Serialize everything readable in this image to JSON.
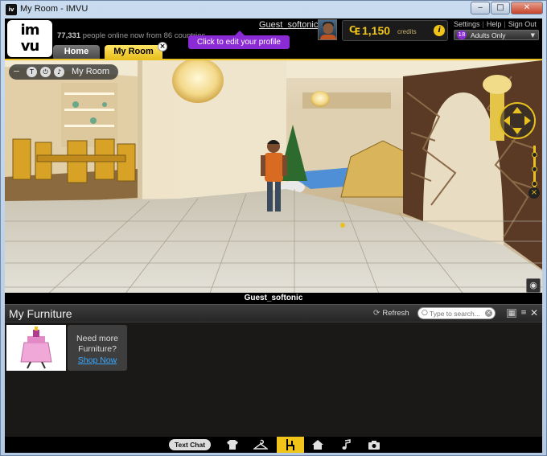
{
  "window": {
    "title": "My Room - IMVU",
    "app_icon": "imvu-icon",
    "minimize": "‒",
    "maximize": "□",
    "close": "✕"
  },
  "header": {
    "logo": "imvu",
    "online_count": "77,331",
    "online_text": "people online now from 86 countries",
    "username": "Guest_softonic",
    "tooltip": "Click to edit your profile",
    "credits_value": "1,150",
    "credits_label": "credits",
    "credits_symbol": "₠",
    "links": [
      "Settings",
      "Help",
      "Sign Out"
    ],
    "adults_badge": "18",
    "adults_label": "Adults Only",
    "tabs": [
      {
        "label": "Home"
      },
      {
        "label": "My Room"
      }
    ],
    "tab_close": "×"
  },
  "scene": {
    "room_name": "My Room",
    "room_controls": [
      "T",
      "⏻",
      "♪"
    ],
    "avatar_name": "Guest_softonic",
    "zoom_plus": "+",
    "zoom_minus": "×"
  },
  "furniture": {
    "title": "My Furniture",
    "refresh_label": "Refresh",
    "search_placeholder": "Type to search...",
    "need_more_line1": "Need more",
    "need_more_line2": "Furniture?",
    "shop_now": "Shop Now"
  },
  "toolbar": {
    "text_chat": "Text Chat",
    "buttons": [
      "shirt-icon",
      "hanger-icon",
      "chair-icon",
      "house-icon",
      "music-icon",
      "camera-icon"
    ],
    "active": "chair-icon"
  },
  "colors": {
    "accent": "#e8c020",
    "tooltip": "#8a2bd6",
    "link": "#38a8ff"
  }
}
